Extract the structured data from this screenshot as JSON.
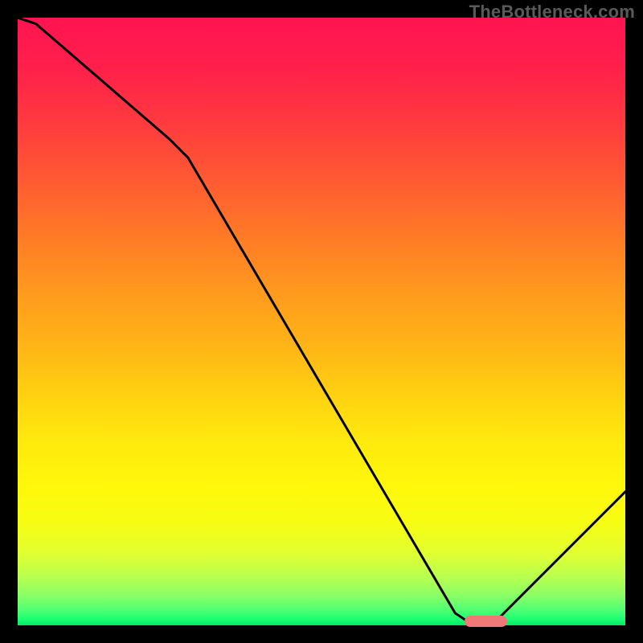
{
  "watermark": "TheBottleneck.com",
  "colors": {
    "background": "#000000",
    "gradient_top": "#ff1452",
    "gradient_bottom": "#00eb6a",
    "curve": "#000000",
    "marker": "#f07878"
  },
  "chart_data": {
    "type": "line",
    "title": "",
    "xlabel": "",
    "ylabel": "",
    "xlim": [
      0,
      100
    ],
    "ylim": [
      0,
      100
    ],
    "x": [
      0,
      3,
      25,
      28,
      72,
      75,
      78,
      100
    ],
    "values": [
      100,
      99,
      80,
      77,
      2,
      0,
      0,
      22
    ],
    "marker": {
      "x_range": [
        73.5,
        80.5
      ],
      "y": 0.7
    },
    "annotations": [],
    "legend": []
  }
}
